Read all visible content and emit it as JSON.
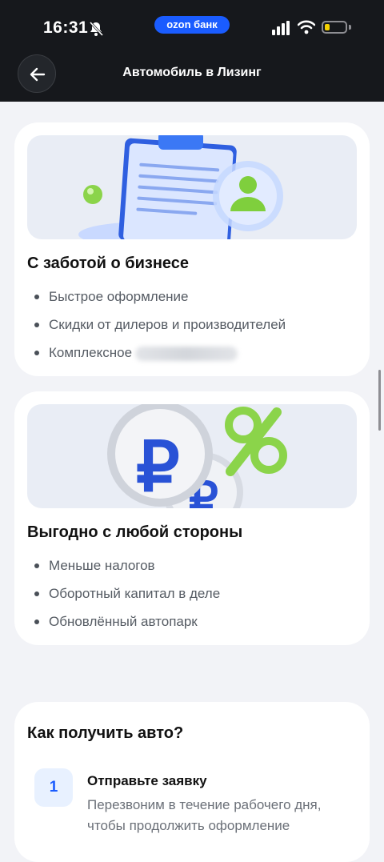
{
  "status_bar": {
    "time": "16:31",
    "bank_badge": "ozon банк",
    "icons": [
      "bell-muted-icon",
      "signal-icon",
      "wifi-icon",
      "battery-icon"
    ]
  },
  "header": {
    "title": "Автомобиль в Лизинг",
    "back_icon": "arrow-left-icon"
  },
  "cards": [
    {
      "title": "С заботой о бизнесе",
      "image": "clipboard-illustration",
      "bullets": [
        "Быстрое оформление",
        "Скидки от дилеров и производителей",
        "Комплексное"
      ]
    },
    {
      "title": "Выгодно с любой стороны",
      "image": "ruble-coins-percent-illustration",
      "bullets": [
        "Меньше налогов",
        "Оборотный капитал в деле",
        "Обновлённый автопарк"
      ]
    }
  ],
  "steps": {
    "title": "Как получить авто?",
    "items": [
      {
        "number": "1",
        "title": "Отправьте заявку",
        "text": "Перезвоним в течение рабочего дня, чтобы продолжить оформление"
      }
    ]
  },
  "colors": {
    "accent": "#1a5cff",
    "header_bg": "#16181c",
    "page_bg": "#f2f3f7"
  }
}
